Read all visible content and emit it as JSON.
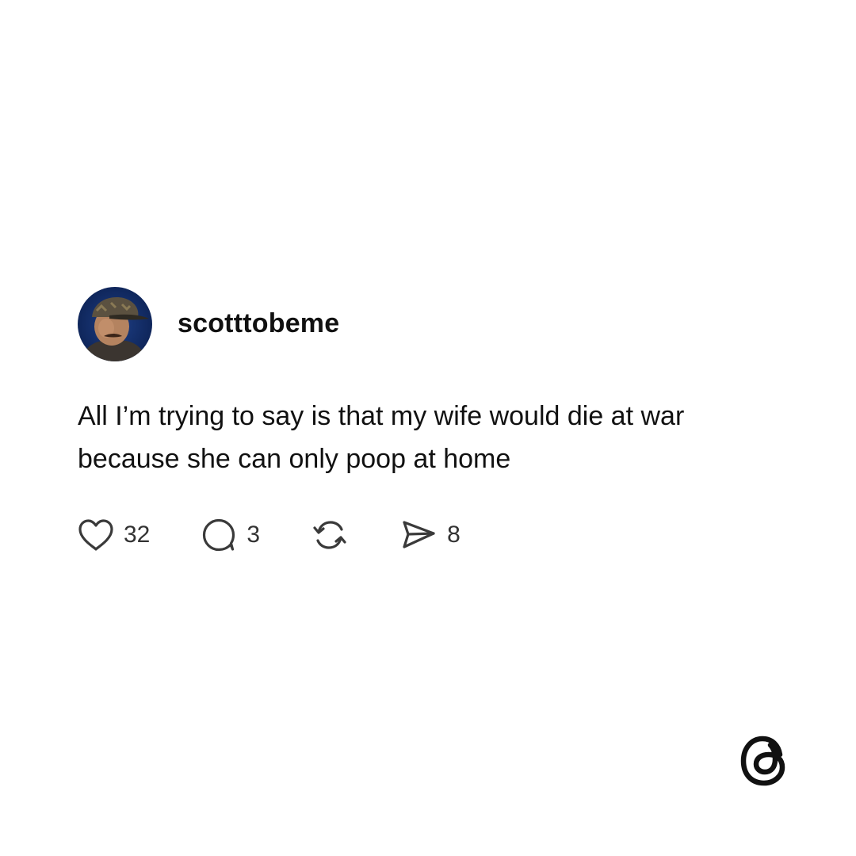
{
  "post": {
    "username": "scotttobeme",
    "text": "All I’m trying to say is that my wife would die at war because she can only poop at home",
    "actions": {
      "likes": "32",
      "comments": "3",
      "shares": "8"
    }
  },
  "icons": {
    "like": "heart-icon",
    "comment": "speech-bubble-icon",
    "repost": "repost-icon",
    "share": "send-icon",
    "brand": "threads-logo-icon"
  },
  "colors": {
    "background": "#ffffff",
    "text": "#111111",
    "icon": "#3a3a3a"
  }
}
